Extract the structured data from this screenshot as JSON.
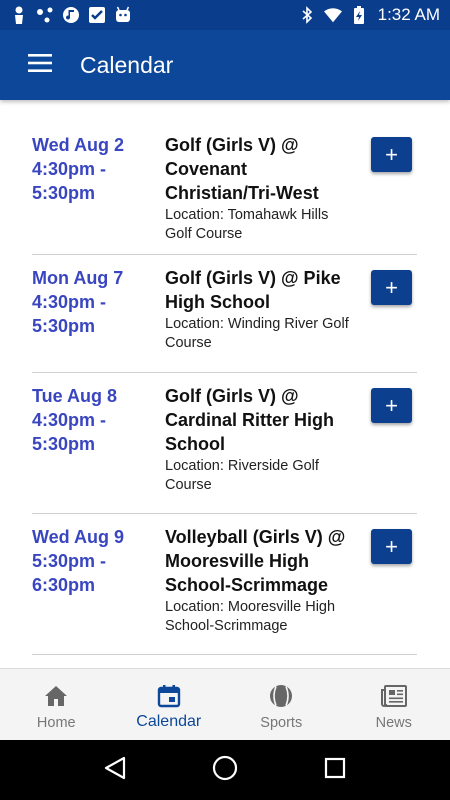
{
  "status_bar": {
    "time": "1:32 AM",
    "left_icons": [
      "person-icon",
      "network-dots-icon",
      "music-icon",
      "checkmark-app-icon",
      "android-robot-icon"
    ],
    "right_icons": [
      "bluetooth-icon",
      "wifi-icon",
      "battery-charging-icon"
    ]
  },
  "app_bar": {
    "title": "Calendar",
    "menu_icon": "hamburger-menu-icon"
  },
  "events": [
    {
      "date": "Wed Aug 2",
      "time_line1": "4:30pm -",
      "time_line2": "5:30pm",
      "title": "Golf (Girls V) @ Covenant Christian/Tri-West",
      "location": "Location: Tomahawk Hills Golf Course",
      "add_label": "+"
    },
    {
      "date": "Mon Aug 7",
      "time_line1": "4:30pm -",
      "time_line2": "5:30pm",
      "title": "Golf (Girls V) @ Pike High School",
      "location": "Location: Winding River Golf Course",
      "add_label": "+"
    },
    {
      "date": "Tue Aug 8",
      "time_line1": "4:30pm -",
      "time_line2": "5:30pm",
      "title": "Golf (Girls V) @ Cardinal Ritter High School",
      "location": "Location: Riverside Golf Course",
      "add_label": "+"
    },
    {
      "date": "Wed Aug 9",
      "time_line1": "5:30pm -",
      "time_line2": "6:30pm",
      "title": "Volleyball (Girls V) @ Mooresville High School-Scrimmage",
      "location": "Location: Mooresville High School-Scrimmage",
      "add_label": "+"
    }
  ],
  "bottom_nav": {
    "items": [
      {
        "label": "Home",
        "icon": "home-icon"
      },
      {
        "label": "Calendar",
        "icon": "calendar-icon",
        "active": true
      },
      {
        "label": "Sports",
        "icon": "baseball-icon"
      },
      {
        "label": "News",
        "icon": "newspaper-icon"
      }
    ]
  },
  "colors": {
    "primary": "#0d4799",
    "status_bar": "#0a3e8c",
    "date_text": "#3a46c0",
    "add_button": "#0d3f8f"
  }
}
